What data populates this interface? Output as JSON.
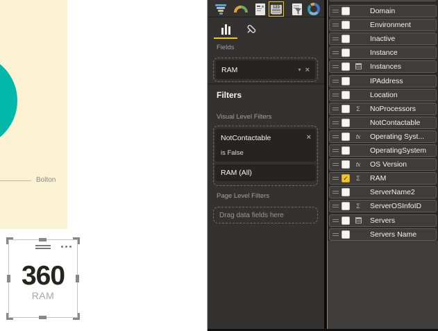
{
  "colors": {
    "accent_yellow": "#F2C811",
    "teal": "#01B8AA",
    "visual_background_cream": "#FBF2D3",
    "pane_dark": "#333231",
    "pill_dark": "#252423"
  },
  "canvas": {
    "donut_visual": {
      "label": "Bolton"
    },
    "card_visual": {
      "value": "360",
      "category": "RAM"
    }
  },
  "viz_pane": {
    "gallery": {
      "icons": [
        "funnel-chart",
        "gauge",
        "multi-row-card",
        "card",
        "slicer",
        "donut-chart"
      ],
      "selected": "card",
      "card_icon_text": "123"
    },
    "tabs": {
      "fields_tab": "fields",
      "format_tab": "format",
      "active": "fields"
    },
    "fields_section": {
      "label": "Fields",
      "well_value": "RAM",
      "dropdown_glyph": "▾",
      "remove_glyph": "×"
    },
    "filters": {
      "heading": "Filters",
      "visual_level_label": "Visual Level Filters",
      "cards": [
        {
          "name": "NotContactable",
          "condition": "is False",
          "remove_glyph": "×"
        },
        {
          "name": "RAM (All)"
        }
      ],
      "page_level_label": "Page Level Filters",
      "drop_placeholder": "Drag data fields here"
    }
  },
  "fields_pane": {
    "items": [
      {
        "label": "Domain",
        "icon": "none",
        "checked": false
      },
      {
        "label": "Environment",
        "icon": "none",
        "checked": false
      },
      {
        "label": "Inactive",
        "icon": "none",
        "checked": false
      },
      {
        "label": "Instance",
        "icon": "none",
        "checked": false
      },
      {
        "label": "Instances",
        "icon": "table",
        "checked": false
      },
      {
        "label": "IPAddress",
        "icon": "none",
        "checked": false
      },
      {
        "label": "Location",
        "icon": "none",
        "checked": false
      },
      {
        "label": "NoProcessors",
        "icon": "sum",
        "checked": false
      },
      {
        "label": "NotContactable",
        "icon": "none",
        "checked": false
      },
      {
        "label": "Operating Syst...",
        "icon": "fx",
        "checked": false
      },
      {
        "label": "OperatingSystem",
        "icon": "none",
        "checked": false
      },
      {
        "label": "OS Version",
        "icon": "fx",
        "checked": false
      },
      {
        "label": "RAM",
        "icon": "sum",
        "checked": true
      },
      {
        "label": "ServerName2",
        "icon": "none",
        "checked": false
      },
      {
        "label": "ServerOSInfoID",
        "icon": "sum",
        "checked": false
      },
      {
        "label": "Servers",
        "icon": "table",
        "checked": false
      },
      {
        "label": "Servers Name",
        "icon": "none",
        "checked": false
      }
    ],
    "icon_glyphs": {
      "sum": "Σ",
      "fx": "fx",
      "check": "✓"
    }
  }
}
